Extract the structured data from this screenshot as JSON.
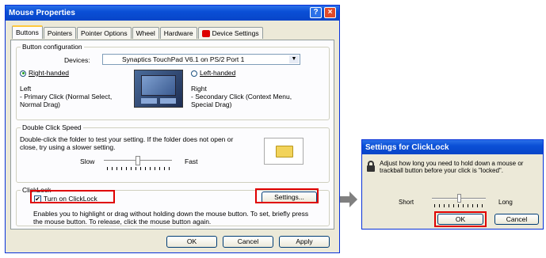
{
  "mouse_window": {
    "title": "Mouse Properties",
    "help_btn": "?",
    "close_btn": "×",
    "tabs": [
      "Buttons",
      "Pointers",
      "Pointer Options",
      "Wheel",
      "Hardware",
      "Device Settings"
    ],
    "button_config": {
      "legend": "Button configuration",
      "devices_label": "Devices:",
      "devices_value": "Synaptics TouchPad V6.1 on PS/2 Port 1",
      "right_handed": "Right-handed",
      "left_handed": "Left-handed",
      "left_desc_title": "Left",
      "left_desc": "- Primary Click (Normal Select, Normal Drag)",
      "right_desc_title": "Right",
      "right_desc": "- Secondary Click (Context Menu, Special Drag)"
    },
    "double_click": {
      "legend": "Double Click Speed",
      "desc": "Double-click the folder to test your setting.  If the folder does not open or close, try using a slower setting.",
      "slow": "Slow",
      "fast": "Fast",
      "level": 0.5
    },
    "clicklock": {
      "legend": "ClickLock",
      "checkbox_label": "Turn on ClickLock",
      "checked": true,
      "settings_btn": "Settings...",
      "desc": "Enables you to highlight or drag without holding down the mouse button.  To set, briefly press the mouse button.  To release, click the mouse button again."
    },
    "footer": {
      "ok": "OK",
      "cancel": "Cancel",
      "apply": "Apply"
    }
  },
  "clicklock_window": {
    "title": "Settings for ClickLock",
    "desc": "Adjust how long you need to hold down a mouse or trackball button before your click is \"locked\".",
    "short": "Short",
    "long": "Long",
    "level": 0.5,
    "ok": "OK",
    "cancel": "Cancel"
  },
  "colors": {
    "highlight": "#e00000",
    "titlebar": "#0a4fd6",
    "arrow": "#808080"
  }
}
